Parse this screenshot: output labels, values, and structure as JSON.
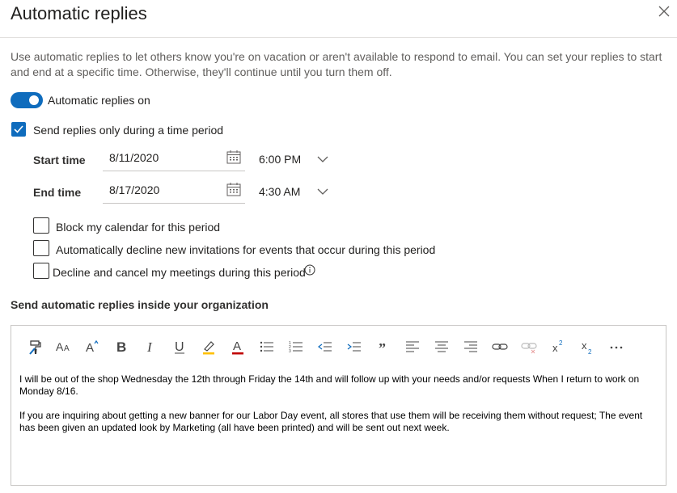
{
  "dialog": {
    "title": "Automatic replies",
    "close_icon": "close-icon",
    "description": "Use automatic replies to let others know you're on vacation or aren't available to respond to email. You can set your replies to start and end at a specific time. Otherwise, they'll continue until you turn them off."
  },
  "toggle": {
    "label": "Automatic replies on",
    "on": true
  },
  "time_period": {
    "label": "Send replies only during a time period",
    "checked": true
  },
  "start": {
    "label": "Start time",
    "date": "8/11/2020",
    "time": "6:00 PM"
  },
  "end": {
    "label": "End time",
    "date": "8/17/2020",
    "time": "4:30 AM"
  },
  "options": [
    {
      "label": "Block my calendar for this period",
      "checked": false
    },
    {
      "label": "Automatically decline new invitations for events that occur during this period",
      "checked": false
    },
    {
      "label": "Decline and cancel my meetings during this period",
      "checked": false
    }
  ],
  "section": {
    "inside_org": "Send automatic replies inside your organization"
  },
  "toolbar": [
    "format-painter-icon",
    "font-size-icon",
    "grow-font-icon",
    "bold-icon",
    "italic-icon",
    "underline-icon",
    "highlight-icon",
    "font-color-icon",
    "bullets-icon",
    "numbering-icon",
    "decrease-indent-icon",
    "increase-indent-icon",
    "quote-icon",
    "align-left-icon",
    "align-center-icon",
    "align-right-icon",
    "link-icon",
    "unlink-icon",
    "superscript-icon",
    "subscript-icon",
    "more-icon"
  ],
  "message": {
    "para1": "I will be out of the shop Wednesday the 12th through Friday the 14th and will follow up with your needs and/or requests When I return to work on Monday 8/16.",
    "para2": "If you are inquiring about getting a new banner for our Labor Day event, all stores that use them will be receiving them without request; The event has been given an updated look by Marketing (all have been printed) and will be sent out next week."
  },
  "colors": {
    "accent": "#0f6cbd",
    "text": "#201f1e",
    "muted": "#605e5c",
    "border": "#c8c6c4"
  }
}
